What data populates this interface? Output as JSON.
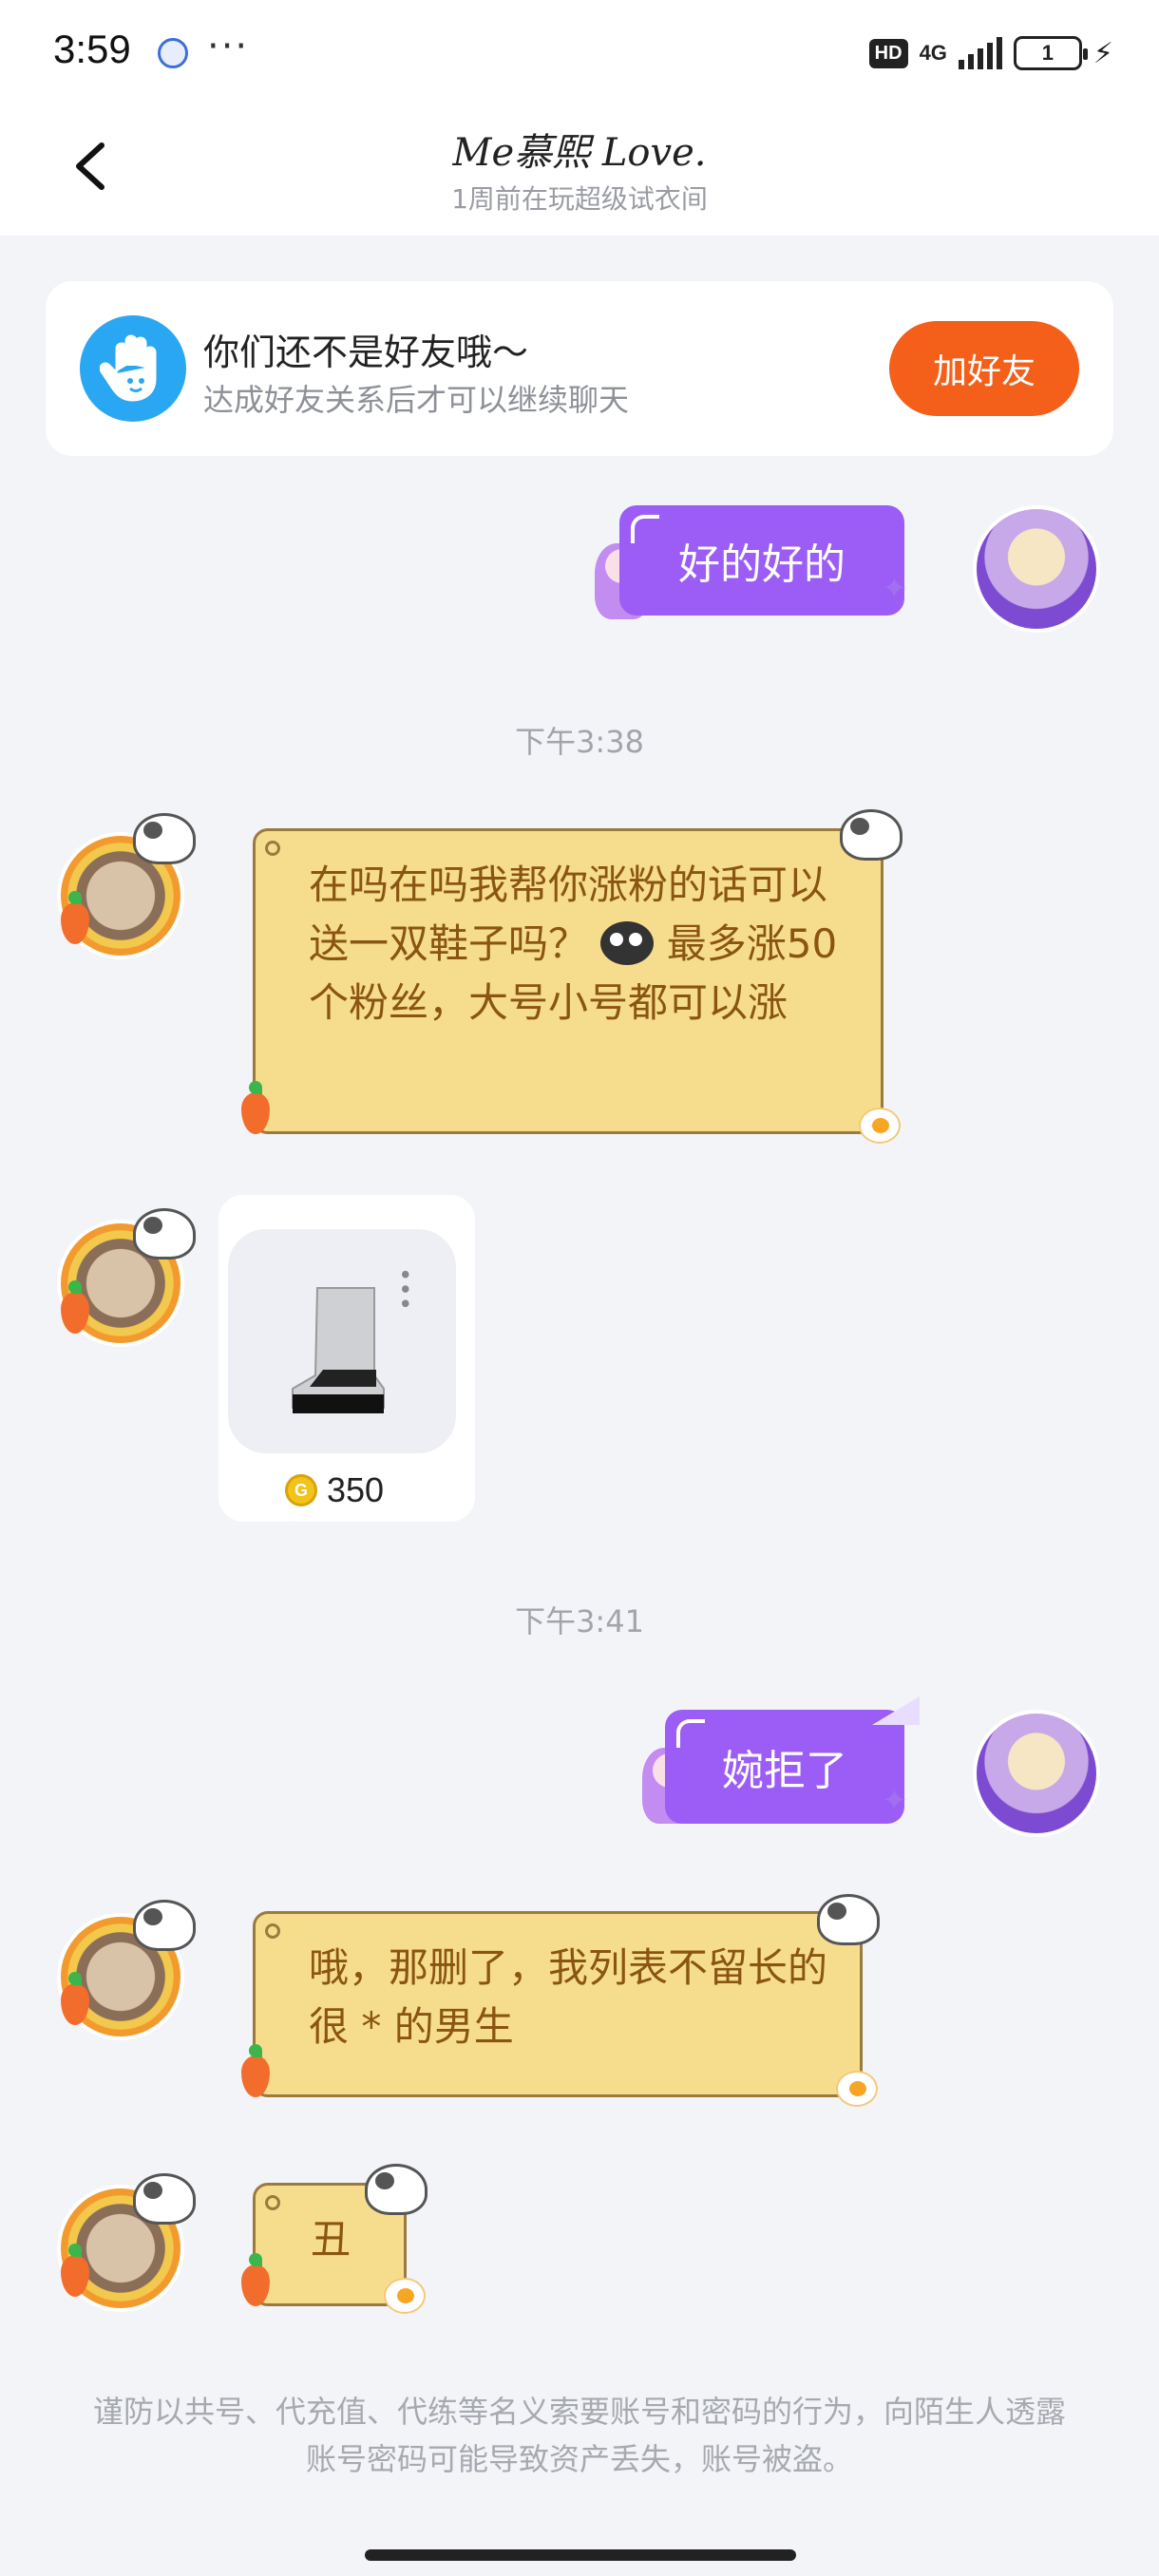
{
  "status_bar": {
    "time": "3:59",
    "more": "···",
    "hd": "HD",
    "network": "4G",
    "battery": "1"
  },
  "header": {
    "title": "Me慕熙 Love.",
    "subtitle": "1周前在玩超级试衣间"
  },
  "friend_banner": {
    "title": "你们还不是好友哦～",
    "subtitle": "达成好友关系后才可以继续聊天",
    "add_button": "加好友"
  },
  "messages": {
    "m1_self": "好的好的",
    "time1": "下午3:38",
    "m2_other_part1": "在吗在吗我帮你涨粉的话可以送一双鞋子吗？",
    "m2_other_part2": "最多涨50个粉丝，大号小号都可以涨",
    "gift_price": "350",
    "time2": "下午3:41",
    "m3_self": "婉拒了",
    "m4_other": "哦，那删了，我列表不留长的很 * 的男生",
    "m5_other": "丑"
  },
  "footer": {
    "note": "谨防以共号、代充值、代练等名义索要账号和密码的行为，向陌生人透露账号密码可能导致资产丢失，账号被盗。"
  },
  "icons": {
    "back": "chevron-left-icon",
    "coin": "coin-icon",
    "hand": "hand-icon"
  },
  "colors": {
    "accent_orange": "#f4601a",
    "bubble_purple": "#9b5df6",
    "bubble_yellow": "#f6dd8e",
    "banner_icon_blue": "#2aa7f2"
  }
}
